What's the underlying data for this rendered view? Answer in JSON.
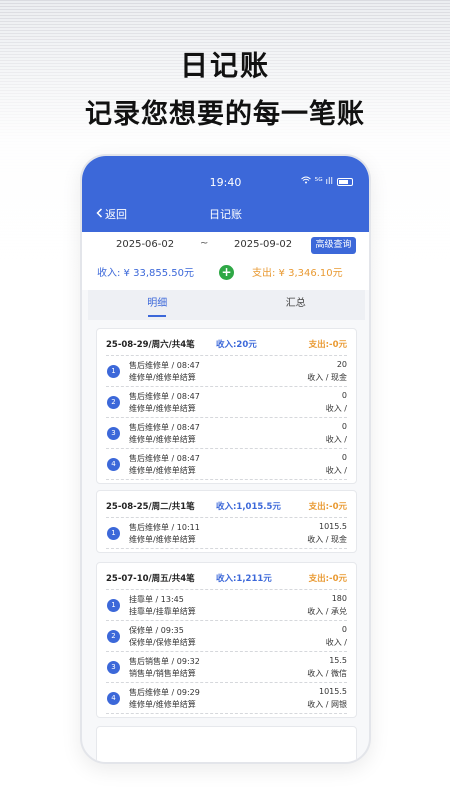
{
  "promo": {
    "title": "日记账",
    "subtitle": "记录您想要的每一笔账"
  },
  "status": {
    "time": "19:40",
    "signal": "⁵ᴳ ıll"
  },
  "nav": {
    "back_label": "返回",
    "title": "日记账"
  },
  "filter": {
    "start_date": "2025-06-02",
    "tilde": "~",
    "end_date": "2025-09-02",
    "advanced_label": "高级查询"
  },
  "totals": {
    "income": "收入: ¥ 33,855.50元",
    "expense": "支出: ¥ 3,346.10元",
    "add": "+"
  },
  "tabs": [
    {
      "label": "明细",
      "active": true
    },
    {
      "label": "汇总",
      "active": false
    }
  ],
  "groups": [
    {
      "date": "25-08-29/周六/共4笔",
      "income": "收入:20元",
      "expense": "支出:-0元",
      "entries": [
        {
          "n": "1",
          "title": "售后维修单 / 08:47",
          "sub": "维修单/维修单结算",
          "amount": "20",
          "detail": "收入 / 现金"
        },
        {
          "n": "2",
          "title": "售后维修单 / 08:47",
          "sub": "维修单/维修单结算",
          "amount": "0",
          "detail": "收入 /"
        },
        {
          "n": "3",
          "title": "售后维修单 / 08:47",
          "sub": "维修单/维修单结算",
          "amount": "0",
          "detail": "收入 /"
        },
        {
          "n": "4",
          "title": "售后维修单 / 08:47",
          "sub": "维修单/维修单结算",
          "amount": "0",
          "detail": "收入 /"
        }
      ]
    },
    {
      "date": "25-08-25/周二/共1笔",
      "income": "收入:1,015.5元",
      "expense": "支出:-0元",
      "entries": [
        {
          "n": "1",
          "title": "售后维修单 / 10:11",
          "sub": "维修单/维修单结算",
          "amount": "1015.5",
          "detail": "收入 / 现金"
        }
      ]
    },
    {
      "date": "25-07-10/周五/共4笔",
      "income": "收入:1,211元",
      "expense": "支出:-0元",
      "entries": [
        {
          "n": "1",
          "title": "挂靠单 / 13:45",
          "sub": "挂靠单/挂靠单结算",
          "amount": "180",
          "detail": "收入 / 承兑"
        },
        {
          "n": "2",
          "title": "保修单 / 09:35",
          "sub": "保修单/保修单结算",
          "amount": "0",
          "detail": "收入 /"
        },
        {
          "n": "3",
          "title": "售后销售单 / 09:32",
          "sub": "销售单/销售单结算",
          "amount": "15.5",
          "detail": "收入 / 微信"
        },
        {
          "n": "4",
          "title": "售后维修单 / 09:29",
          "sub": "维修单/维修单结算",
          "amount": "1015.5",
          "detail": "收入 / 网银"
        }
      ]
    }
  ]
}
